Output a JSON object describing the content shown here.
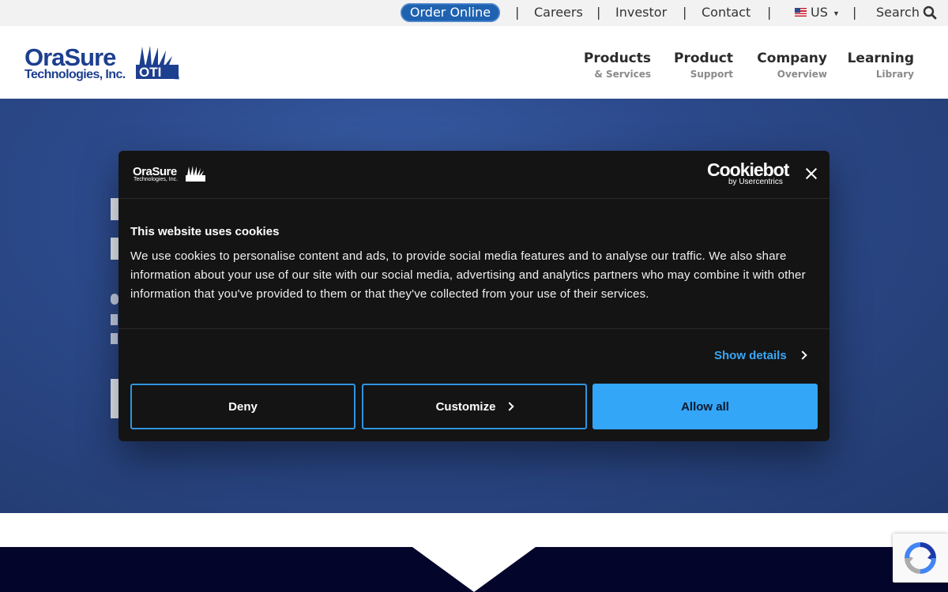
{
  "topbar": {
    "order_online": "Order Online",
    "separator": "|",
    "careers": "Careers",
    "investor": "Investor",
    "contact": "Contact",
    "region": "US",
    "search": "Search"
  },
  "logo": {
    "name": "OraSure",
    "subtitle": "Technologies, Inc.",
    "mark": "OTI",
    "tm": "TM"
  },
  "nav": [
    {
      "main": "Products",
      "sub": "& Services"
    },
    {
      "main": "Product",
      "sub": "Support"
    },
    {
      "main": "Company",
      "sub": "Overview"
    },
    {
      "main": "Learning",
      "sub": "Library"
    }
  ],
  "cookie": {
    "logo_name": "OraSure",
    "logo_sub": "Technologies, Inc.",
    "cookiebot": "Cookiebot",
    "cookiebot_sub": "by Usercentrics",
    "title": "This website uses cookies",
    "body": "We use cookies to personalise content and ads, to provide social media features and to analyse our traffic. We also share information about your use of our site with our social media, advertising and analytics partners who may combine it with other information that you've provided to them or that they've collected from your use of their services.",
    "show_details": "Show details",
    "deny": "Deny",
    "customize": "Customize",
    "allow_all": "Allow all"
  },
  "colors": {
    "brand_blue": "#1d3f8f",
    "accent_blue": "#33a6f8",
    "hero_blue": "#2c4a8c",
    "dark_band": "#03052a"
  }
}
